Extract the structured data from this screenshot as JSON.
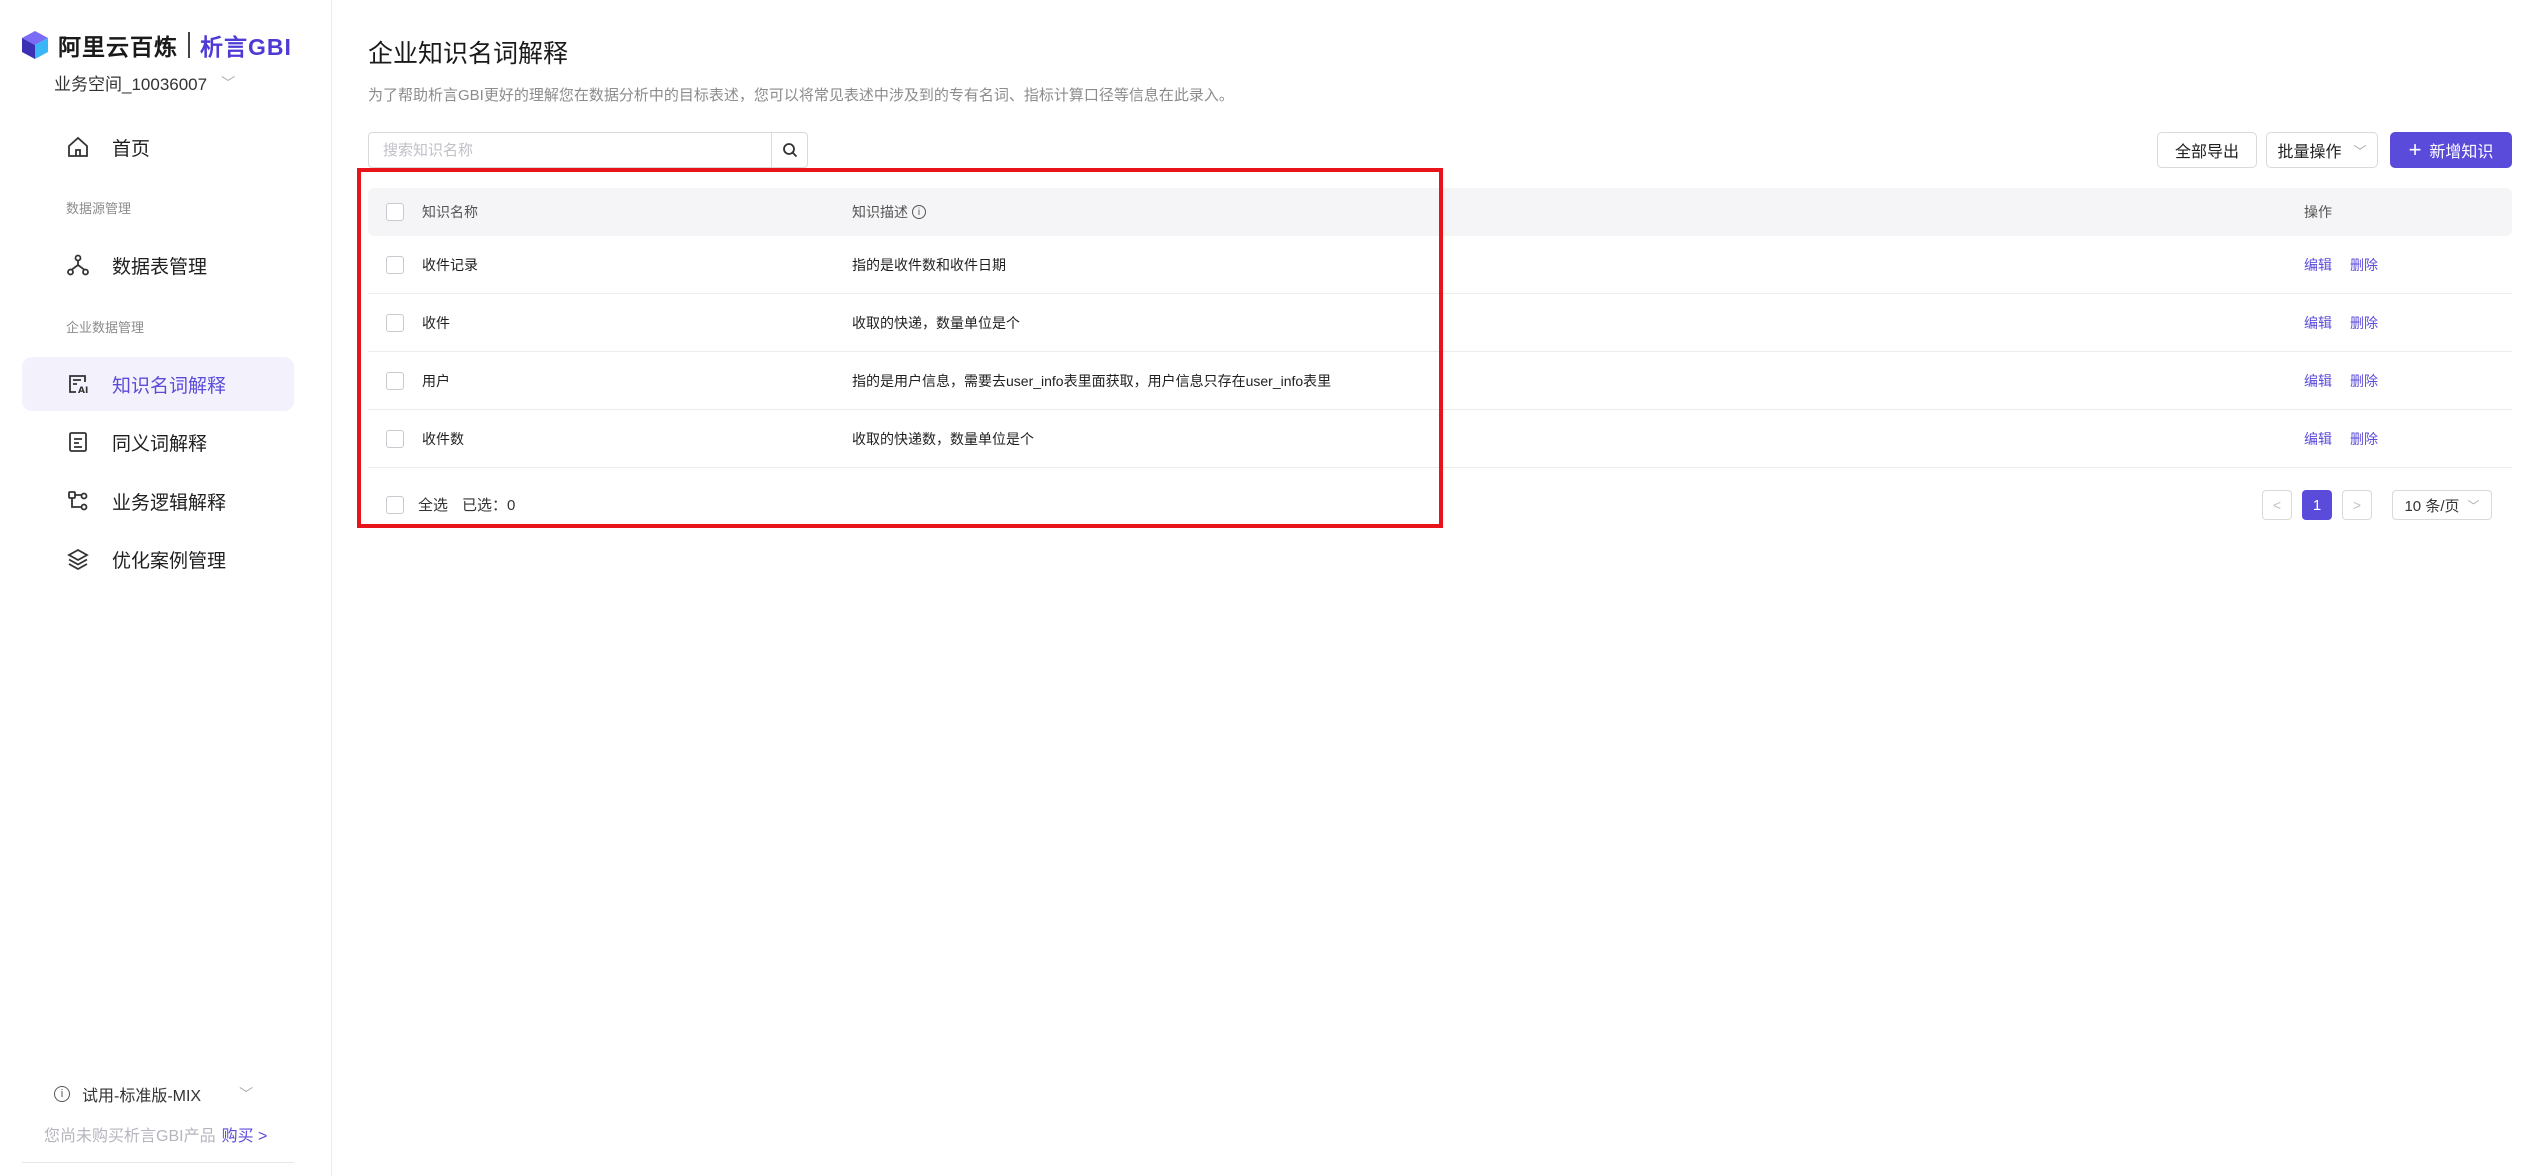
{
  "brand": {
    "name": "阿里云百炼",
    "product": "析言GBI",
    "accent": "#5b4bdb"
  },
  "workspace": {
    "label": "业务空间_10036007"
  },
  "nav": {
    "home": "首页",
    "group_datasource": "数据源管理",
    "table_manage": "数据表管理",
    "group_enterprise": "企业数据管理",
    "knowledge": "知识名词解释",
    "synonym": "同义词解释",
    "logic": "业务逻辑解释",
    "cases": "优化案例管理"
  },
  "plan": {
    "label": "试用-标准版-MIX",
    "notice": "您尚未购买析言GBI产品",
    "buy": "购买"
  },
  "page": {
    "title": "企业知识名词解释",
    "description": "为了帮助析言GBI更好的理解您在数据分析中的目标表述，您可以将常见表述中涉及到的专有名词、指标计算口径等信息在此录入。"
  },
  "toolbar": {
    "search_placeholder": "搜索知识名称",
    "export_all": "全部导出",
    "batch": "批量操作",
    "add": "新增知识"
  },
  "table": {
    "headers": {
      "name": "知识名称",
      "desc": "知识描述",
      "ops": "操作"
    },
    "rows": [
      {
        "name": "收件记录",
        "desc": "指的是收件数和收件日期"
      },
      {
        "name": "收件",
        "desc": "收取的快递，数量单位是个"
      },
      {
        "name": "用户",
        "desc": "指的是用户信息，需要去user_info表里面获取，用户信息只存在user_info表里"
      },
      {
        "name": "收件数",
        "desc": "收取的快递数，数量单位是个"
      }
    ],
    "edit": "编辑",
    "delete": "删除"
  },
  "footer": {
    "select_all": "全选",
    "selected": "已选：0"
  },
  "pagination": {
    "current": "1",
    "page_size": "10 条/页"
  }
}
